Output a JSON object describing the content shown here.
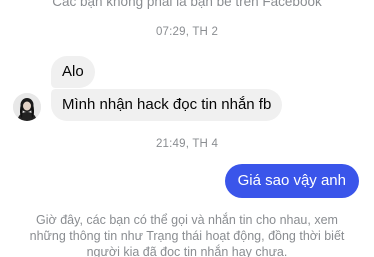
{
  "header": {
    "notice": "Các bạn không phải là bạn bè trên Facebook"
  },
  "conversation": {
    "timestamp_1": "07:29, TH 2",
    "incoming_1": "Alo",
    "incoming_2": "Mình nhận hack đọc tin nhắn fb",
    "timestamp_2": "21:49, TH 4",
    "outgoing_1": "Giá sao vậy anh"
  },
  "footer": {
    "notice": "Giờ đây, các bạn có thể gọi và nhắn tin cho nhau, xem những thông tin như Trạng thái hoạt động, đồng thời biết người kia đã đọc tin nhắn hay chưa."
  },
  "colors": {
    "outgoing_bubble": "#3a55ea",
    "incoming_bubble": "#f0f0f0",
    "meta_text": "#8a8d91"
  },
  "icons": {
    "avatar": "contact-avatar"
  }
}
